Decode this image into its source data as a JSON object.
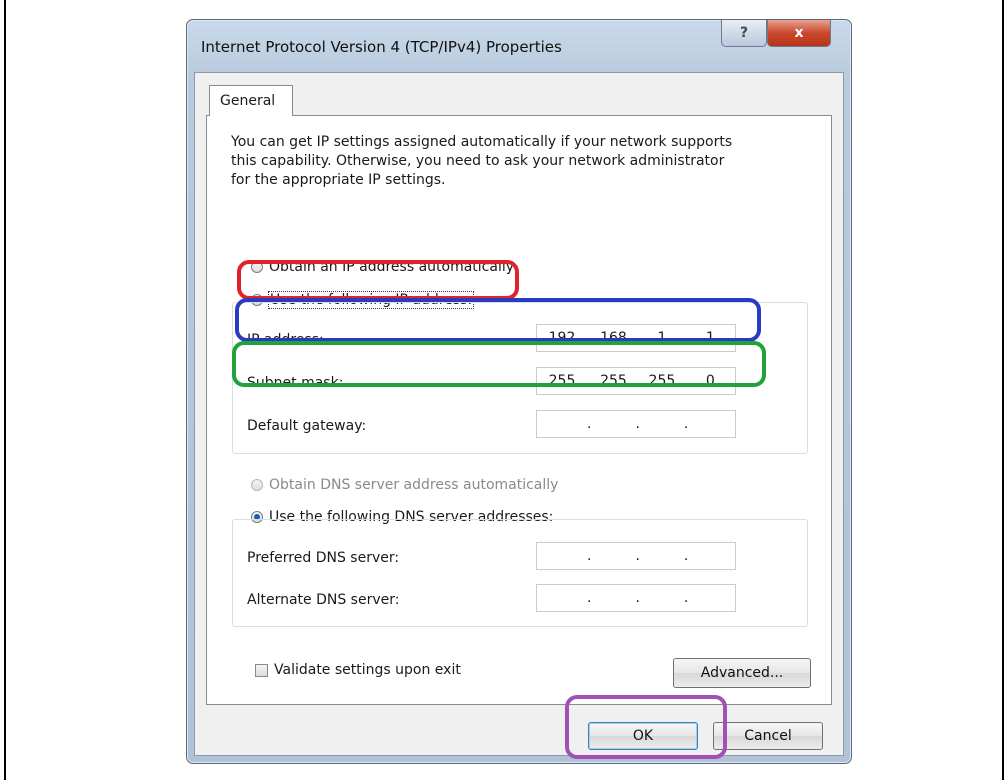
{
  "dialog": {
    "title": "Internet Protocol Version 4 (TCP/IPv4) Properties",
    "help_glyph": "?",
    "close_glyph": "x"
  },
  "tab": {
    "label": "General"
  },
  "description": "You can get IP settings assigned automatically if your network supports\nthis capability. Otherwise, you need to ask your network administrator\nfor the appropriate IP settings.",
  "ip_mode": {
    "auto_label": "Obtain an IP address automatically",
    "manual_label": "Use the following IP address:",
    "selected": "manual"
  },
  "ip_fields": {
    "ip_address": {
      "label": "IP address:",
      "octets": [
        "192",
        "168",
        "1",
        "1"
      ]
    },
    "subnet_mask": {
      "label": "Subnet mask:",
      "octets": [
        "255",
        "255",
        "255",
        "0"
      ]
    },
    "default_gateway": {
      "label": "Default gateway:",
      "octets": [
        "",
        "",
        "",
        ""
      ]
    }
  },
  "dns_mode": {
    "auto_label": "Obtain DNS server address automatically",
    "manual_label": "Use the following DNS server addresses:",
    "selected": "manual"
  },
  "dns_fields": {
    "preferred": {
      "label": "Preferred DNS server:",
      "octets": [
        "",
        "",
        "",
        ""
      ]
    },
    "alternate": {
      "label": "Alternate DNS server:",
      "octets": [
        "",
        "",
        "",
        ""
      ]
    }
  },
  "validate": {
    "label": "Validate settings upon exit",
    "checked": false
  },
  "buttons": {
    "advanced": "Advanced...",
    "ok": "OK",
    "cancel": "Cancel"
  },
  "highlight_colors": {
    "red": "#e0232a",
    "blue": "#2a3bc2",
    "green": "#22a33a",
    "purple": "#a350b5"
  }
}
